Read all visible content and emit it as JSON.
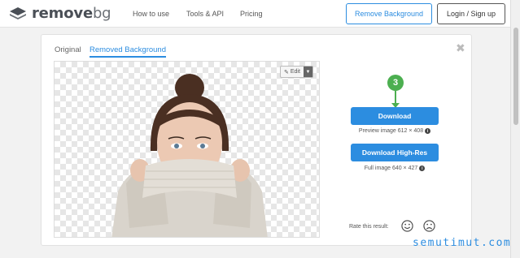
{
  "header": {
    "logo_text": "remove",
    "logo_text_suffix": "bg",
    "nav": [
      "How to use",
      "Tools & API",
      "Pricing"
    ],
    "cta_label": "Remove Background",
    "login_label": "Login / Sign up"
  },
  "tabs": {
    "original": "Original",
    "removed": "Removed Background"
  },
  "preview": {
    "edit_label": "Edit"
  },
  "actions": {
    "step_number": "3",
    "download_label": "Download",
    "preview_meta": "Preview image 612 × 408",
    "hires_label": "Download High-Res",
    "full_meta": "Full image 640 × 427",
    "rate_label": "Rate this result:"
  },
  "watermark": "semutimut.com",
  "colors": {
    "accent": "#2c8de0",
    "step": "#4caf50"
  }
}
